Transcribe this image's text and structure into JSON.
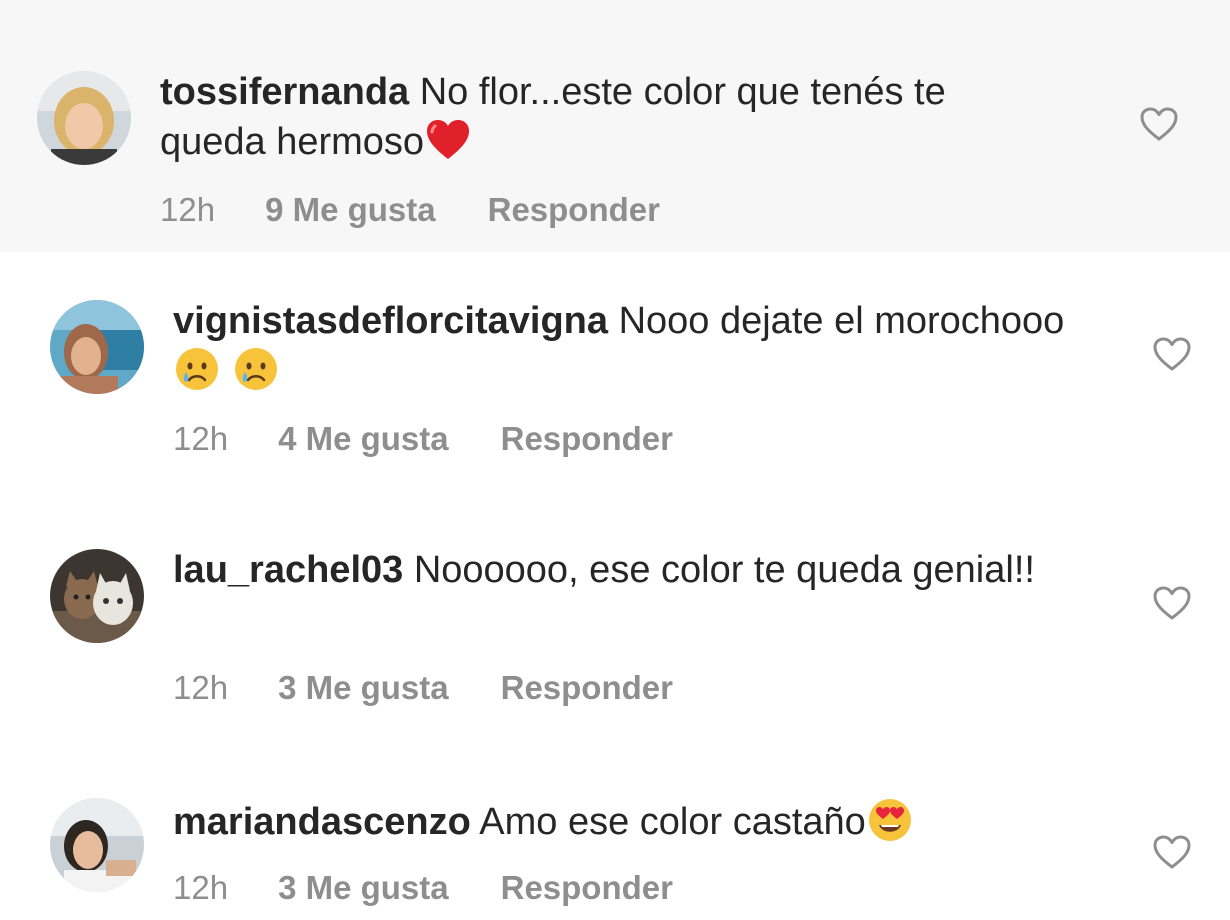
{
  "comments": [
    {
      "username": "tossifernanda",
      "text": " No flor...este color que tenés te queda hermoso",
      "emojis": [
        "red-heart"
      ],
      "time": "12h",
      "likes": "9 Me gusta",
      "reply": "Responder"
    },
    {
      "username": "vignistasdeflorcitavigna",
      "text": " Nooo dejate el morochooo",
      "emojis": [
        "crying-face",
        "crying-face"
      ],
      "time": "12h",
      "likes": "4 Me gusta",
      "reply": "Responder"
    },
    {
      "username": "lau_rachel03",
      "text": " Noooooo, ese color te queda genial!!",
      "emojis": [],
      "time": "12h",
      "likes": "3 Me gusta",
      "reply": "Responder"
    },
    {
      "username": "mariandascenzo",
      "text": " Amo ese color castaño",
      "emojis": [
        "smiling-face-with-heart-eyes"
      ],
      "time": "12h",
      "likes": "3 Me gusta",
      "reply": "Responder"
    }
  ],
  "colors": {
    "highlight_background": "#f7f7f7",
    "text": "#262626",
    "meta": "#8e8e8e",
    "heart_outline": "#8e8e8e"
  },
  "icons": {
    "like": "heart-outline-icon"
  }
}
